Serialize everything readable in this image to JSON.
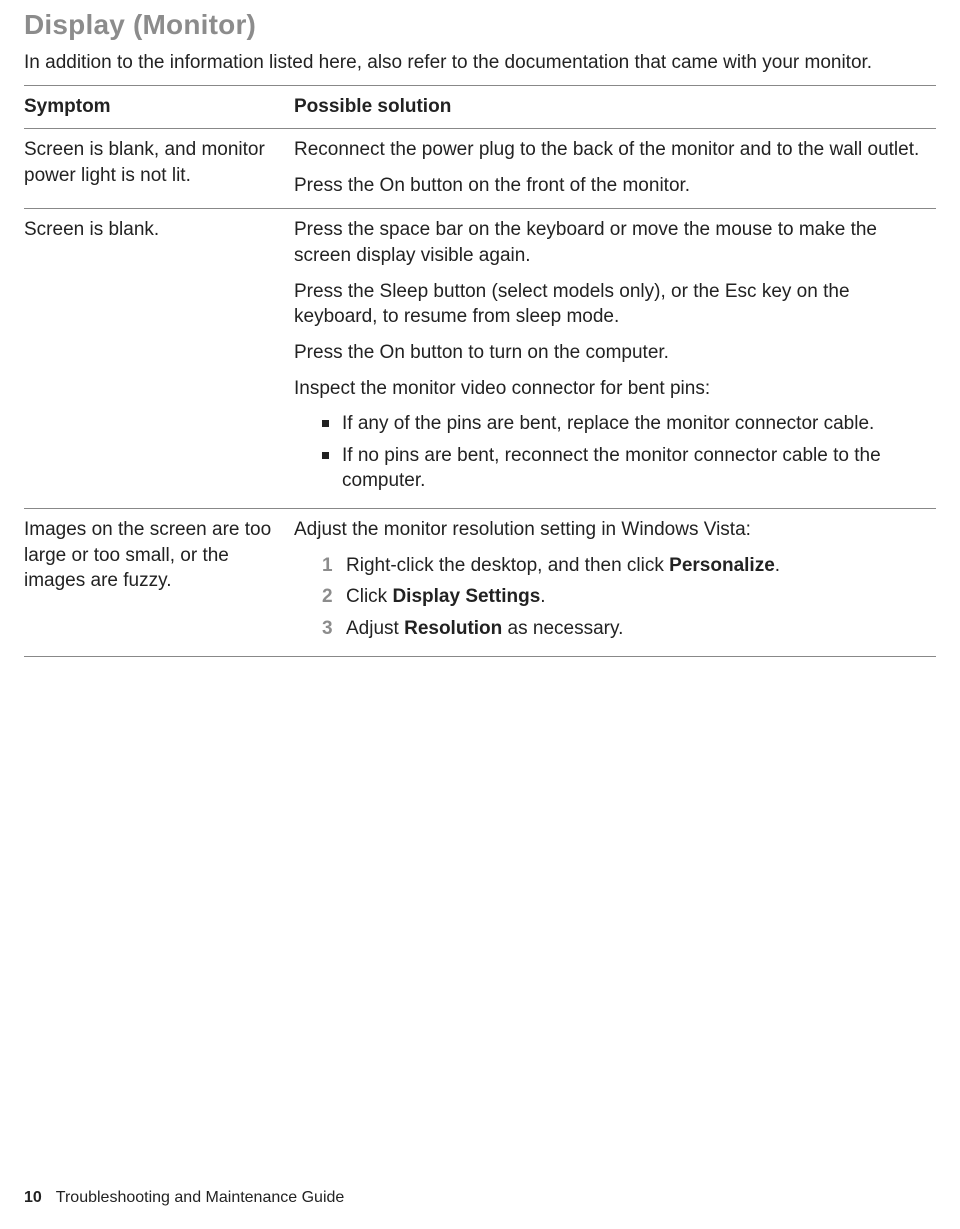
{
  "section": {
    "title": "Display (Monitor)",
    "intro": "In addition to the information listed here, also refer to the documentation that came with your monitor."
  },
  "table": {
    "headers": {
      "symptom": "Symptom",
      "solution": "Possible solution"
    },
    "rows": [
      {
        "symptom": "Screen is blank, and monitor power light is not lit.",
        "solution": {
          "paras": [
            "Reconnect the power plug to the back of the monitor and to the wall outlet.",
            "Press the On button on the front of the monitor."
          ]
        }
      },
      {
        "symptom": "Screen is blank.",
        "solution": {
          "paras": [
            "Press the space bar on the keyboard or move the mouse to make the screen display visible again.",
            "Press the Sleep button (select models only), or the Esc key on the keyboard, to resume from sleep mode.",
            "Press the On button to turn on the computer.",
            "Inspect the monitor video connector for bent pins:"
          ],
          "bullets": [
            "If any of the pins are bent, replace the monitor connector cable.",
            "If no pins are bent, reconnect the monitor connector cable to the computer."
          ]
        }
      },
      {
        "symptom": "Images on the screen are too large or too small, or the images are fuzzy.",
        "solution": {
          "lead": "Adjust the monitor resolution setting in Windows Vista:",
          "steps": [
            {
              "pre": "Right-click the desktop, and then click ",
              "bold": "Personalize",
              "post": "."
            },
            {
              "pre": "Click ",
              "bold": "Display Settings",
              "post": "."
            },
            {
              "pre": "Adjust ",
              "bold": "Resolution",
              "post": " as necessary."
            }
          ]
        }
      }
    ]
  },
  "footer": {
    "page_number": "10",
    "doc_title": "Troubleshooting and Maintenance Guide"
  }
}
